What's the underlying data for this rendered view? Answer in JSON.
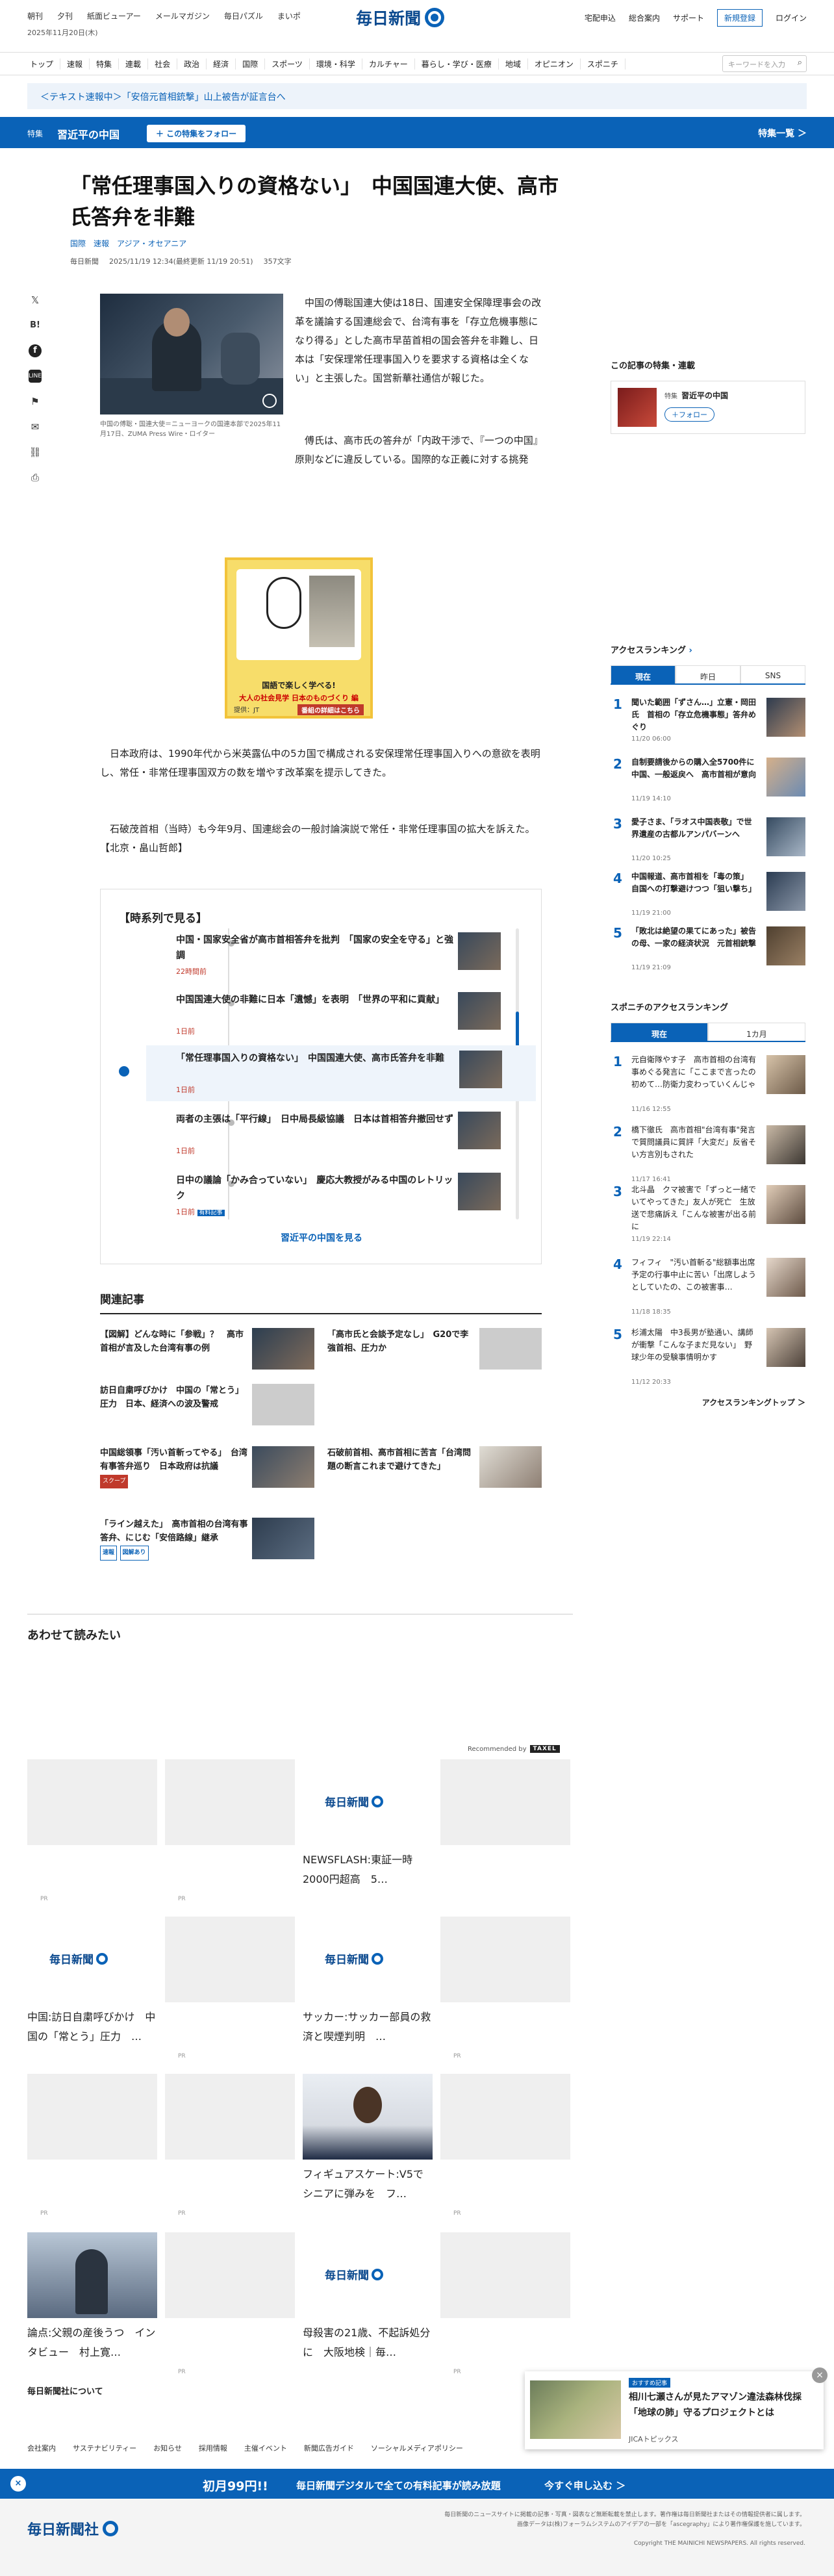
{
  "header": {
    "util_left": [
      "朝刊",
      "夕刊",
      "紙面ビューアー",
      "メールマガジン",
      "毎日パズル",
      "まいポ"
    ],
    "date": "2025年11月20日(木)",
    "logo": "毎日新聞",
    "util_right": [
      "宅配申込",
      "総合案内",
      "サポート"
    ],
    "register": "新規登録",
    "login": "ログイン"
  },
  "nav": {
    "items": [
      "トップ",
      "速報",
      "特集",
      "連載",
      "社会",
      "政治",
      "経済",
      "国際",
      "スポーツ",
      "環境・科学",
      "カルチャー",
      "暮らし・学び・医療",
      "地域",
      "オピニオン",
      "スポニチ"
    ],
    "search_placeholder": "キーワードを入力"
  },
  "ticker": "＜テキスト速報中＞「安倍元首相銃撃」山上被告が証言台へ",
  "feature": {
    "tag": "特集",
    "title": "習近平の中国",
    "follow": "＋ この特集をフォロー",
    "list": "特集一覧 ＞"
  },
  "article": {
    "title": "「常任理事国入りの資格ない」　中国国連大使、高市氏答弁を非難",
    "categories": [
      "国際",
      "速報",
      "アジア・オセアニア"
    ],
    "source": "毎日新聞",
    "datetime": "2025/11/19 12:34(最終更新 11/19 20:51)",
    "chars": "357文字",
    "caption": "中国の傅聡・国連大使＝ニューヨークの国連本部で2025年11月17日、ZUMA Press Wire・ロイター",
    "p1": "中国の傅聡国連大使は18日、国連安全保障理事会の改革を議論する国連総会で、台湾有事を「存立危機事態になり得る」とした高市早苗首相の国会答弁を非難し、日本は「安保理常任理事国入りを要求する資格は全くない」と主張した。国営新華社通信が報じた。",
    "p2": "傅氏は、高市氏の答弁が「内政干渉で、『一つの中国』原則などに違反している。国際的な正義に対する挑発で、平和の道を歩むという日本の基本的な約束に公然と背いた」などと非難。「台湾は中国の不可分の領土だ」とも訴えた。",
    "p3": "日本政府は、1990年代から米英露仏中の5カ国で構成される安保理常任理事国入りへの意欲を表明し、常任・非常任理事国双方の数を増やす改革案を提示してきた。",
    "p4": "石破茂首相（当時）も今年9月、国連総会の一般討論演説で常任・非常任理事国の拡大を訴えた。【北京・畠山哲郎】",
    "share_icons": [
      "x-icon",
      "hatena-icon",
      "facebook-icon",
      "line-icon",
      "bookmark-icon",
      "mail-icon",
      "link-icon",
      "print-icon"
    ]
  },
  "ad": {
    "line1": "国語で楽しく学べる!",
    "line2": "大人の社会見学 日本のものづくり 編",
    "sponsor": "提供：JT",
    "cta": "番組の詳細はこちら"
  },
  "timeseries": {
    "heading": "【時系列で見る】",
    "items": [
      {
        "title": "中国・国家安全省が高市首相答弁を批判　「国家の安全を守る」と強調",
        "time": "22時間前"
      },
      {
        "title": "中国国連大使の非難に日本「遺憾」を表明　「世界の平和に貢献」",
        "time": "1日前"
      },
      {
        "title": "「常任理事国入りの資格ない」　中国国連大使、高市氏答弁を非難",
        "time": "1日前"
      },
      {
        "title": "両者の主張は「平行線」　日中局長級協議　日本は首相答弁撤回せず",
        "time": "1日前"
      },
      {
        "title": "日中の議論「かみ合っていない」　慶応大教授がみる中国のレトリック",
        "time": "1日前",
        "badge": "有料記事"
      }
    ],
    "more": "習近平の中国を見る"
  },
  "related": {
    "heading": "関連記事",
    "items": [
      {
        "title": "【図解】どんな時に「参戦」？　高市首相が言及した台湾有事の例"
      },
      {
        "title": "「高市氏と会談予定なし」　G20で李強首相、圧力か"
      },
      {
        "title": "訪日自粛呼びかけ　中国の「常とう」圧力　日本、経済への波及警戒"
      },
      {
        "title": "中国総領事「汚い首斬ってやる」　台湾有事答弁巡り　日本政府は抗議",
        "badge": "スクープ"
      },
      {
        "title": "石破前首相、高市首相に苦言「台湾問題の断言これまで避けてきた」"
      },
      {
        "title": "「ライン越えた」　高市首相の台湾有事答弁、にじむ「安倍路線」継承",
        "badges": [
          "速報",
          "図解あり"
        ]
      }
    ]
  },
  "readmore": {
    "heading": "あわせて読みたい",
    "recommended": "Recommended by",
    "recbrand": "TAXEL",
    "pr": "PR",
    "cards": [
      {
        "text": ""
      },
      {
        "text": ""
      },
      {
        "text": "NEWSFLASH:東証一時2000円超高　5…"
      },
      {
        "text": ""
      },
      {
        "text": ""
      },
      {
        "text": ""
      },
      {
        "text": "中国:訪日自粛呼びかけ　中国の「常とう」圧力　…"
      },
      {
        "text": ""
      },
      {
        "text": "サッカー:サッカー部員の救済と喫煙判明　…"
      },
      {
        "text": ""
      },
      {
        "text": ""
      },
      {
        "text": ""
      },
      {
        "text": "フィギュアスケート:V5でシニアに弾みを　フ…"
      },
      {
        "text": ""
      },
      {
        "text": "論点:父親の産後うつ　インタビュー　村上寛…"
      },
      {
        "text": ""
      },
      {
        "text": "母殺害の21歳、不起訴処分に　大阪地検｜毎…"
      },
      {
        "text": ""
      }
    ]
  },
  "sidebar": {
    "follow_heading": "この記事の特集・連載",
    "follow_tag": "特集",
    "follow_title": "習近平の中国",
    "follow_btn": "＋フォロー",
    "ranking_heading": "アクセスランキング",
    "ranking_tabs": [
      "現在",
      "昨日",
      "SNS"
    ],
    "ranking": [
      {
        "n": "1",
        "title": "聞いた範囲「ずさん…」立憲・岡田氏　首相の「存立危機事態」答弁めぐり",
        "date": "11/20 06:00"
      },
      {
        "n": "2",
        "title": "自制要請後からの購入全5700件に　中国、一般返戻へ　高市首相が意向",
        "date": "11/19 14:10"
      },
      {
        "n": "3",
        "title": "愛子さま、「ラオス中国表敬」で世界遺産の古都ルアンパバーンへ",
        "date": "11/20 10:25"
      },
      {
        "n": "4",
        "title": "中国報道、高市首相を「毒の策」　自国への打撃避けつつ「狙い撃ち」",
        "date": "11/19 21:00"
      },
      {
        "n": "5",
        "title": "「敗北は絶望の果てにあった」被告の母、一家の経済状況　元首相銃撃",
        "date": "11/19 21:09"
      }
    ],
    "sponichi_heading": "スポニチのアクセスランキング",
    "sponichi_tabs": [
      "現在",
      "1カ月"
    ],
    "sponichi": [
      {
        "n": "1",
        "title": "元自衛隊やす子　高市首相の台湾有事めぐる発言に「ここまで言ったの初めて…防衛力変わっていくんじゃ",
        "date": "11/16 12:55"
      },
      {
        "n": "2",
        "title": "橋下徹氏　高市首相\"台湾有事\"発言で質問議員に質評「大変だ」反省そい方言別もされた",
        "date": "11/17 16:41"
      },
      {
        "n": "3",
        "title": "北斗晶　クマ被害で「ずっと一緒でいてやってきた」友人が死亡　生放送で悲痛訴え「こんな被害が出る前に",
        "date": "11/19 22:14"
      },
      {
        "n": "4",
        "title": "フィフィ　\"汚い首斬る\"総額事出席予定の行事中止に苦い「出席しようとしていたの、この被害事…",
        "date": "11/18 18:35"
      },
      {
        "n": "5",
        "title": "杉浦太陽　中3長男が塾通い、講師が衝撃「こんな子まだ見ない」　野球少年の受験事情明かす",
        "date": "11/12 20:33"
      }
    ],
    "ranking_more": "アクセスランキングトップ ＞"
  },
  "popup": {
    "badge": "おすすめ記事",
    "title": "相川七瀬さんが見たアマゾン違法森林伐採「地球の肺」守るプロジェクトとは",
    "source": "JICAトピックス",
    "close": "×"
  },
  "footer": {
    "about": "毎日新聞社について",
    "links": [
      "会社案内",
      "サステナビリティー",
      "お知らせ",
      "採用情報",
      "主催イベント",
      "新聞広告ガイド",
      "ソーシャルメディアポリシー"
    ],
    "banner_price": "初月99円!!",
    "banner_text": "毎日新聞デジタルで全ての有料記事が読み放題",
    "banner_cta": "今すぐ申し込む ＞",
    "logo": "毎日新聞社",
    "notice1": "毎日新聞のニュースサイトに掲載の記事・写真・図表など無断転載を禁止します。著作権は毎日新聞社またはその情報提供者に属します。",
    "notice2": "画像データは(株)フォーラムシステムのアイデアの一部を「ascegraphy」により著作権保護を施しています。",
    "copyright": "Copyright THE MAINICHI NEWSPAPERS. All rights reserved."
  },
  "colors": {
    "brand": "#0a62b7",
    "accent_red": "#c0392b"
  }
}
